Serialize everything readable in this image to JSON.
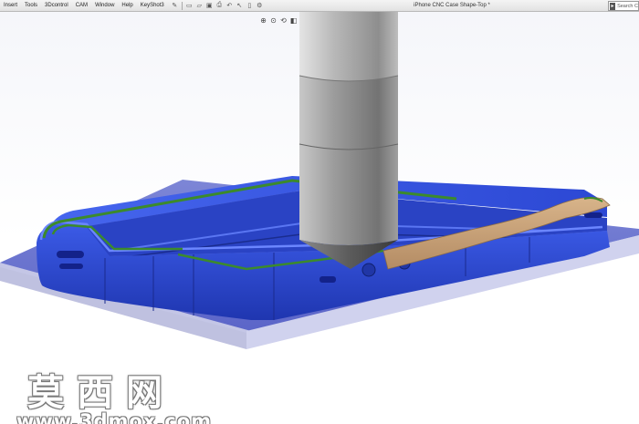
{
  "menubar": {
    "items": [
      "Insert",
      "Tools",
      "3Dcontrol",
      "CAM",
      "Window",
      "Help",
      "KeyShot3"
    ],
    "toolbar_icons": [
      "pin-icon",
      "new-document-icon",
      "open-icon",
      "save-icon",
      "print-icon",
      "undo-icon",
      "select-icon",
      "rebuild-icon",
      "options-icon"
    ],
    "document_title": "iPhone CNC Case Shape-Top *",
    "search_placeholder": "Search C"
  },
  "heads_up_toolbar": {
    "icons": [
      "zoom-to-fit-icon",
      "zoom-area-icon",
      "previous-view-icon",
      "section-view-icon",
      "view-orientation-icon",
      "display-style-icon",
      "hide-show-icon",
      "appearance-icon",
      "scene-icon",
      "view-settings-icon"
    ]
  },
  "watermark": {
    "chinese": "莫西网",
    "url": "www.3dmox.com"
  },
  "colors": {
    "fixture_blue": "#2d4fd6",
    "plate_gray": "#c9cbe8",
    "tool_gray": "#9a9a9a",
    "stock_tan": "#c8a27a",
    "toolpath_green": "#3c8a2c"
  }
}
